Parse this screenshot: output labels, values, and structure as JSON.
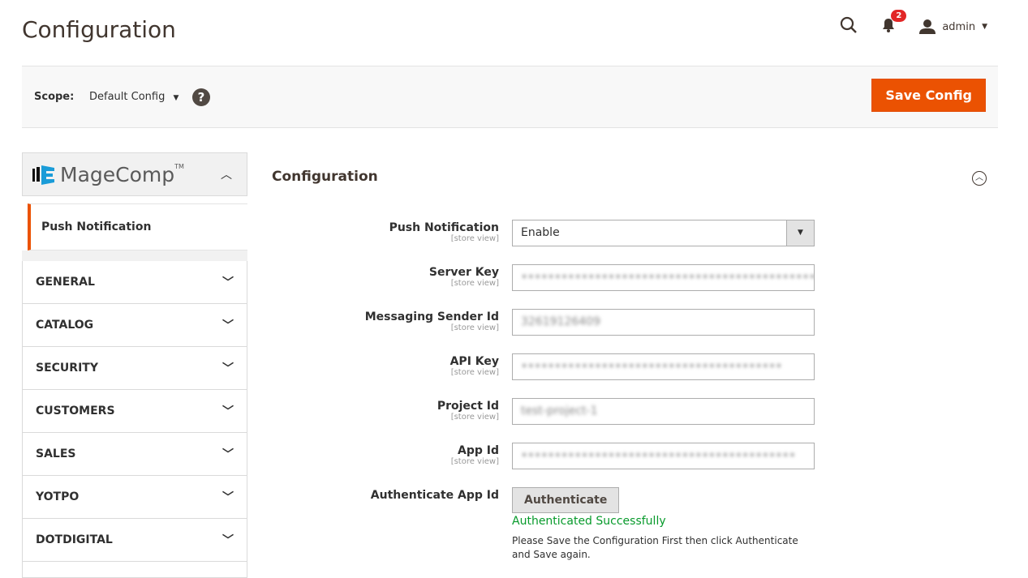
{
  "header": {
    "title": "Configuration",
    "notifications_count": "2",
    "user": "admin"
  },
  "scope": {
    "label": "Scope:",
    "value": "Default Config",
    "help": "?",
    "save_label": "Save Config"
  },
  "sidebar": {
    "brand": "MageComp",
    "brand_tm": "TM",
    "active_item": "Push Notification",
    "sections": [
      {
        "label": "GENERAL"
      },
      {
        "label": "CATALOG"
      },
      {
        "label": "SECURITY"
      },
      {
        "label": "CUSTOMERS"
      },
      {
        "label": "SALES"
      },
      {
        "label": "YOTPO"
      },
      {
        "label": "DOTDIGITAL"
      }
    ]
  },
  "main": {
    "title": "Configuration",
    "fields": [
      {
        "label": "Push Notification",
        "scope": "[store view]",
        "value": "Enable"
      },
      {
        "label": "Server Key",
        "scope": "[store view]",
        "value": "••••••••••••••••••••••••••••••••••••••••••••••••••••••••••••••••"
      },
      {
        "label": "Messaging Sender Id",
        "scope": "[store view]",
        "value": "32619126409"
      },
      {
        "label": "API Key",
        "scope": "[store view]",
        "value": "•••••••••••••••••••••••••••••••••••••••"
      },
      {
        "label": "Project Id",
        "scope": "[store view]",
        "value": "test-project-1"
      },
      {
        "label": "App Id",
        "scope": "[store view]",
        "value": "•••••••••••••••••••••••••••••••••••••••••"
      }
    ],
    "auth": {
      "label": "Authenticate App Id",
      "button": "Authenticate",
      "status": "Authenticated Successfully",
      "note": "Please Save the Configuration First then click Authenticate and Save again."
    }
  },
  "colors": {
    "accent": "#eb5202",
    "success": "#079a2b"
  }
}
